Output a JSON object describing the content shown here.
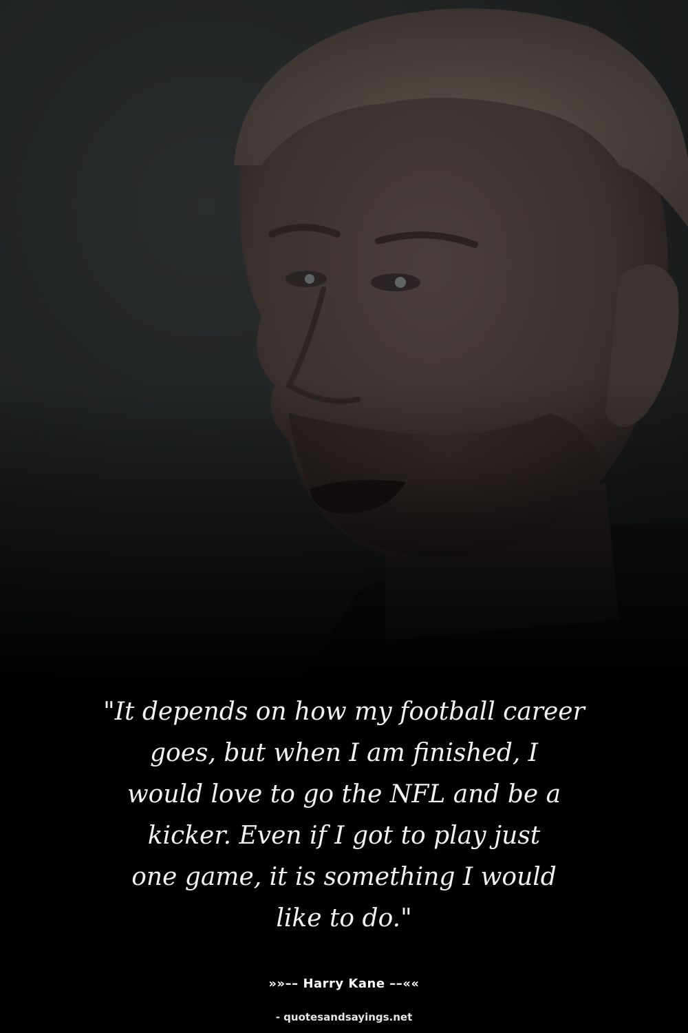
{
  "quote": {
    "lines": [
      "\"It depends on how my football career",
      "goes, but when I am finished, I",
      "would love to go the NFL and be a",
      "kicker. Even if I got to play just",
      "one game, it is something I would",
      "like to do.\""
    ]
  },
  "author": {
    "line": "»»–– Harry Kane ––««"
  },
  "source": {
    "site": "- quotesandsayings.net"
  },
  "photo": {
    "subject": "portrait-photo"
  },
  "colors": {
    "background": "#000000",
    "quote_text": "#f2f2f2",
    "author_text": "#ffffff"
  }
}
